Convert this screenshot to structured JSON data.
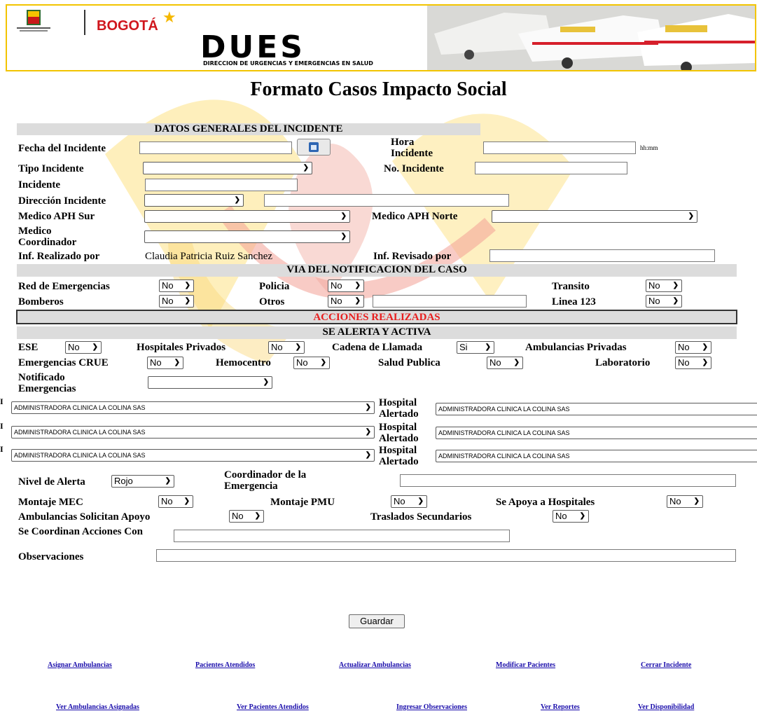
{
  "header": {
    "city_name": "BOGOTÁ",
    "logo_word": "DUES",
    "logo_subtitle": "DIRECCION DE URGENCIAS Y EMERGENCIAS EN SALUD"
  },
  "title": "Formato Casos Impacto Social",
  "sections": {
    "general": "DATOS GENERALES DEL INCIDENTE",
    "via": "VIA DEL NOTIFICACION DEL CASO",
    "acciones": "ACCIONES REALIZADAS",
    "alerta": "SE ALERTA Y ACTIVA"
  },
  "general": {
    "fecha_label": "Fecha del Incidente",
    "hora_label": "Hora Incidente",
    "hora_hint": "hh:mm",
    "tipo_label": "Tipo Incidente",
    "no_incidente_label": "No. Incidente",
    "incidente_label": "Incidente",
    "direccion_label": "Dirección Incidente",
    "medico_sur_label": "Medico APH Sur",
    "medico_norte_label": "Medico APH Norte",
    "medico_coord_label": "Medico Coordinador",
    "realizado_label": "Inf. Realizado por",
    "realizado_value": "Claudia Patricia Ruiz Sanchez",
    "revisado_label": "Inf. Revisado por"
  },
  "via": {
    "red_label": "Red de Emergencias",
    "red_value": "No",
    "policia_label": "Policia",
    "policia_value": "No",
    "transito_label": "Transito",
    "transito_value": "No",
    "bomberos_label": "Bomberos",
    "bomberos_value": "No",
    "otros_label": "Otros",
    "otros_value": "No",
    "linea_label": "Linea 123",
    "linea_value": "No"
  },
  "alerta": {
    "ese_label": "ESE",
    "ese_value": "No",
    "hosp_priv_label": "Hospitales Privados",
    "hosp_priv_value": "No",
    "cadena_label": "Cadena de Llamada",
    "cadena_value": "Si",
    "amb_priv_label": "Ambulancias Privadas",
    "amb_priv_value": "No",
    "crue_label": "Emergencias CRUE",
    "crue_value": "No",
    "hemocentro_label": "Hemocentro",
    "hemocentro_value": "No",
    "salud_label": "Salud Publica",
    "salud_value": "No",
    "laboratorio_label": "Laboratorio",
    "laboratorio_value": "No",
    "notificado_label": "Notificado Emergencias",
    "hospital_label": "Hospital Alertado",
    "hospital_rows": [
      {
        "left_value": "ADMINISTRADORA CLINICA LA COLINA SAS",
        "right_value": "ADMINISTRADORA CLINICA LA COLINA SAS"
      },
      {
        "left_value": "ADMINISTRADORA CLINICA LA COLINA SAS",
        "right_value": "ADMINISTRADORA CLINICA LA COLINA SAS"
      },
      {
        "left_value": "ADMINISTRADORA CLINICA LA COLINA SAS",
        "right_value": "ADMINISTRADORA CLINICA LA COLINA SAS"
      }
    ]
  },
  "extra": {
    "nivel_label": "Nivel de Alerta",
    "nivel_value": "Rojo",
    "coordinador_label": "Coordinador de la Emergencia",
    "mec_label": "Montaje MEC",
    "mec_value": "No",
    "pmu_label": "Montaje PMU",
    "pmu_value": "No",
    "apoya_label": "Se Apoya a Hospitales",
    "apoya_value": "No",
    "amb_apoyo_label": "Ambulancias Solicitan Apoyo",
    "amb_apoyo_value": "No",
    "traslados_label": "Traslados Secundarios",
    "traslados_value": "No",
    "coordinan_label": "Se Coordinan Acciones Con",
    "observaciones_label": "Observaciones"
  },
  "save_button": "Guardar",
  "links_row1": [
    "Asignar Ambulancias",
    "Pacientes Atendidos",
    "Actualizar Ambulancias",
    "Modificar Pacientes",
    "Cerrar Incidente"
  ],
  "links_row2": [
    "Ver Ambulancias Asignadas",
    "Ver Pacientes Atendidos",
    "Ingresar Observaciones",
    "Ver Reportes",
    "Ver Disponibilidad"
  ],
  "colors": {
    "accent_red": "#e81e1e",
    "section_gray": "#dcdcdc",
    "link_blue": "#1a0dab",
    "header_border": "#f2c400"
  }
}
